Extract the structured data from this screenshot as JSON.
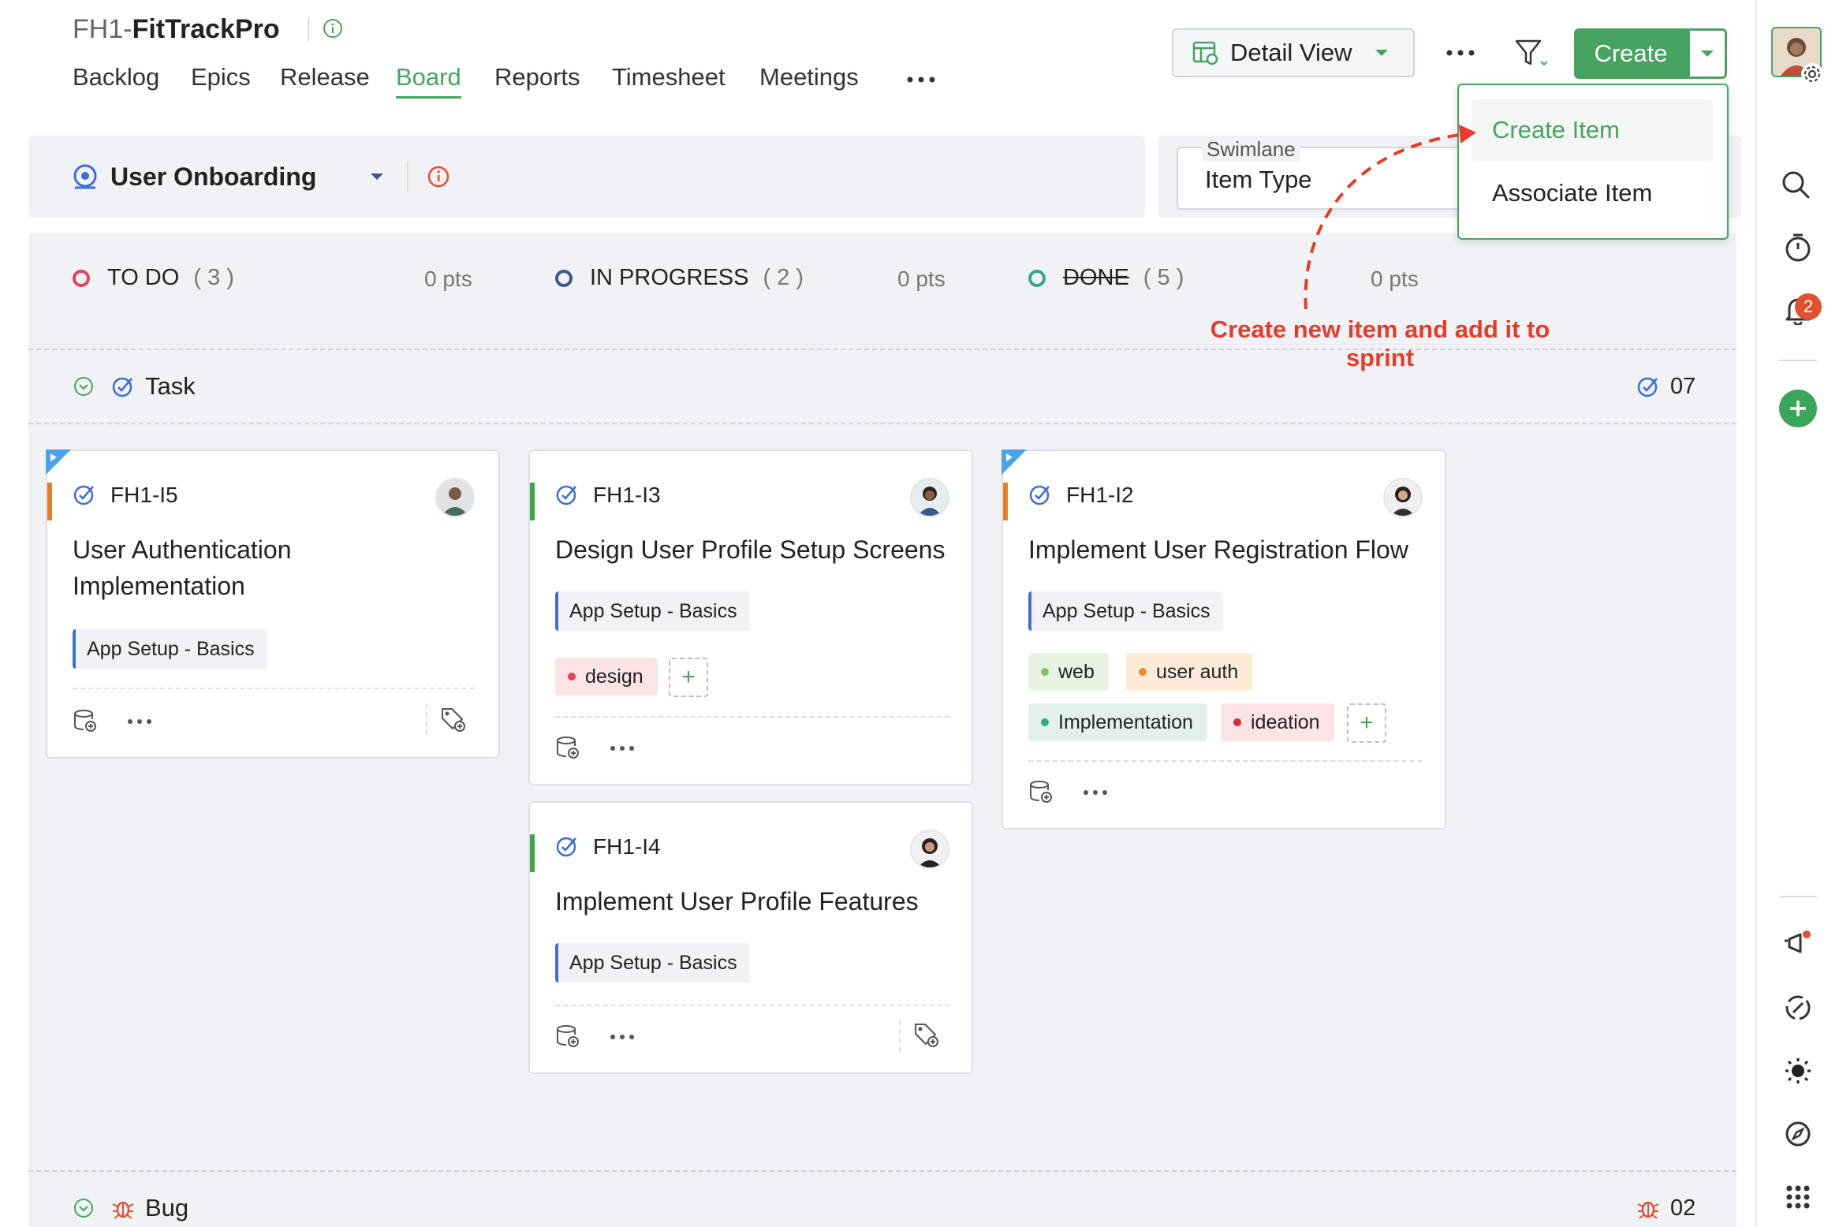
{
  "header": {
    "project_key": "FH1-",
    "project_name": "FitTrackPro",
    "nav": [
      "Backlog",
      "Epics",
      "Release",
      "Board",
      "Reports",
      "Timesheet",
      "Meetings"
    ],
    "active_tab": "Board",
    "view_label": "Detail View",
    "create_label": "Create"
  },
  "create_menu": {
    "items": [
      "Create Item",
      "Associate Item"
    ]
  },
  "sprint": {
    "name": "User Onboarding"
  },
  "swimlane": {
    "label": "Swimlane",
    "value": "Item Type"
  },
  "columns": [
    {
      "name": "TO DO",
      "count": "( 3 )",
      "pts": "0 pts",
      "color": "#e2445c"
    },
    {
      "name": "IN PROGRESS",
      "count": "( 2 )",
      "pts": "0 pts",
      "color": "#3b5a8a"
    },
    {
      "name": "DONE",
      "count": "( 5 )",
      "pts": "0 pts",
      "color": "#3aa687"
    }
  ],
  "lanes": {
    "task": {
      "title": "Task",
      "count": "07"
    },
    "bug": {
      "title": "Bug",
      "count": "02"
    }
  },
  "cards": {
    "i5": {
      "key": "FH1-I5",
      "title_line1": "User Authentication",
      "title_line2": "Implementation",
      "epic": "App Setup - Basics"
    },
    "i3": {
      "key": "FH1-I3",
      "title": "Design User Profile Setup Screens",
      "epic": "App Setup - Basics",
      "tags": [
        "design"
      ]
    },
    "i4": {
      "key": "FH1-I4",
      "title": "Implement User Profile Features",
      "epic": "App Setup - Basics"
    },
    "i2": {
      "key": "FH1-I2",
      "title": "Implement User Registration Flow",
      "epic": "App Setup - Basics",
      "tags": [
        "web",
        "user auth",
        "Implementation",
        "ideation"
      ]
    }
  },
  "notifications": {
    "badge": "2"
  },
  "annotation": {
    "line1": "Create new item and add it to",
    "line2": "sprint"
  },
  "colors": {
    "accent": "#46a460",
    "annotation": "#e53c2a",
    "epic_border": "#3b6ed6"
  }
}
